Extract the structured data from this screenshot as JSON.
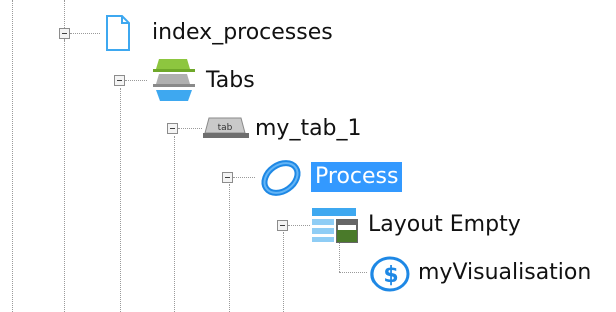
{
  "tree": {
    "nodes": [
      {
        "label": "index_processes",
        "icon": "document-icon",
        "expanded": true,
        "selected": false
      },
      {
        "label": "Tabs",
        "icon": "tabs-stack-icon",
        "expanded": true,
        "selected": false
      },
      {
        "label": "my_tab_1",
        "icon": "tab-icon",
        "icon_text": "tab",
        "expanded": true,
        "selected": false
      },
      {
        "label": "Process",
        "icon": "process-ring-icon",
        "expanded": true,
        "selected": true
      },
      {
        "label": "Layout Empty",
        "icon": "layout-icon",
        "expanded": true,
        "selected": false
      },
      {
        "label": "myVisualisation",
        "icon": "visualisation-dollar-icon",
        "expanded": false,
        "selected": false
      }
    ]
  },
  "colors": {
    "selection": "#3399ff",
    "tree_line": "#9a9a9a",
    "tabs_green": "#8dc63f",
    "tabs_gray": "#a6a6a6",
    "tabs_blue": "#3ea8f0",
    "process_blue": "#1e88e5"
  }
}
